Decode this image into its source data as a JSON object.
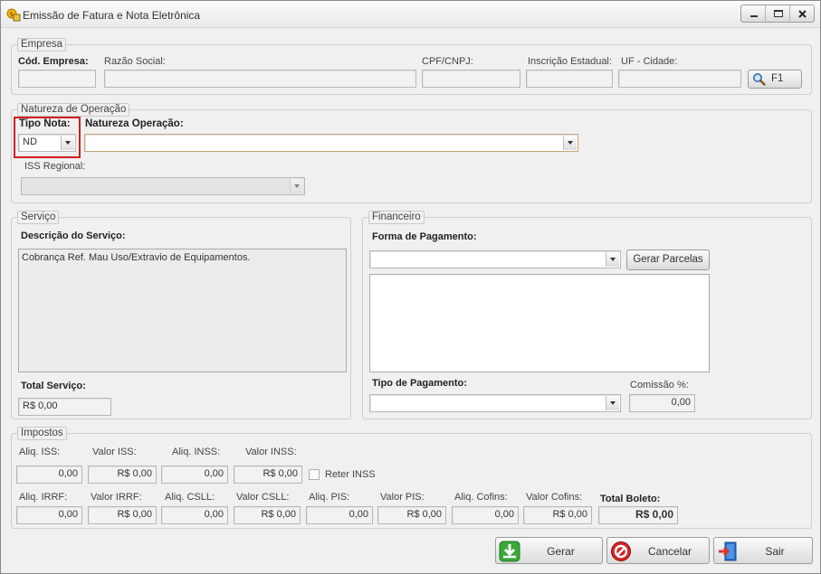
{
  "window": {
    "title": "Emissão de Fatura e Nota Eletrônica"
  },
  "empresa": {
    "legend": "Empresa",
    "cod_label": "Cód. Empresa:",
    "razao_label": "Razão Social:",
    "cpf_label": "CPF/CNPJ:",
    "ie_label": "Inscrição Estadual:",
    "uf_label": "UF - Cidade:",
    "cod_value": "",
    "razao_value": "",
    "cpf_value": "",
    "ie_value": "",
    "uf_value": "",
    "search_button": "F1"
  },
  "natureza": {
    "legend": "Natureza de Operação",
    "tipo_nota_label": "Tipo Nota:",
    "tipo_nota_value": "ND",
    "natureza_label": "Natureza Operação:",
    "natureza_value": "",
    "iss_regional_label": "ISS Regional:",
    "iss_regional_value": ""
  },
  "servico": {
    "legend": "Serviço",
    "descricao_label": "Descrição do Serviço:",
    "descricao_value": "Cobrança Ref. Mau Uso/Extravio de Equipamentos.",
    "total_label": "Total Serviço:",
    "total_value": "R$ 0,00"
  },
  "financeiro": {
    "legend": "Financeiro",
    "forma_label": "Forma de Pagamento:",
    "forma_value": "",
    "gerar_parcelas": "Gerar Parcelas",
    "tipo_pagamento_label": "Tipo de Pagamento:",
    "tipo_pagamento_value": "",
    "comissao_label": "Comissão %:",
    "comissao_value": "0,00"
  },
  "impostos": {
    "legend": "Impostos",
    "row1": [
      {
        "label": "Aliq. ISS:",
        "value": "0,00"
      },
      {
        "label": "Valor ISS:",
        "value": "R$ 0,00"
      },
      {
        "label": "Aliq. INSS:",
        "value": "0,00"
      },
      {
        "label": "Valor INSS:",
        "value": "R$ 0,00"
      }
    ],
    "reter_inss": "Reter INSS",
    "row2": [
      {
        "label": "Aliq. IRRF:",
        "value": "0,00"
      },
      {
        "label": "Valor IRRF:",
        "value": "R$ 0,00"
      },
      {
        "label": "Aliq. CSLL:",
        "value": "0,00"
      },
      {
        "label": "Valor CSLL:",
        "value": "R$ 0,00"
      },
      {
        "label": "Aliq. PIS:",
        "value": "0,00"
      },
      {
        "label": "Valor PIS:",
        "value": "R$ 0,00"
      },
      {
        "label": "Aliq. Cofins:",
        "value": "0,00"
      },
      {
        "label": "Valor Cofins:",
        "value": "R$ 0,00"
      }
    ],
    "total_boleto_label": "Total Boleto:",
    "total_boleto_value": "R$ 0,00"
  },
  "actions": {
    "gerar": "Gerar",
    "cancelar": "Cancelar",
    "sair": "Sair"
  },
  "colors": {
    "highlight": "#d11f1f",
    "gerar_icon": "#3aa83a",
    "cancel_icon": "#c81e1e",
    "exit_icon": "#2a6fc9"
  }
}
